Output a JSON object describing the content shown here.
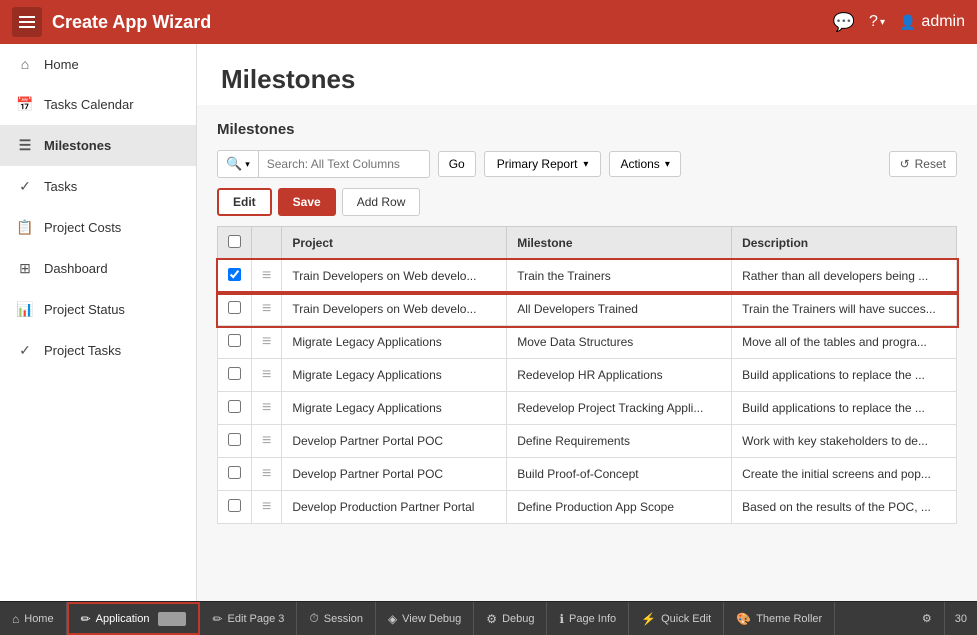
{
  "app": {
    "title": "Create App Wizard"
  },
  "nav_icons": {
    "chat": "💬",
    "help": "?",
    "user": "👤",
    "username": "admin"
  },
  "sidebar": {
    "items": [
      {
        "id": "home",
        "label": "Home",
        "icon": "⌂",
        "active": false
      },
      {
        "id": "tasks-calendar",
        "label": "Tasks Calendar",
        "icon": "📅",
        "active": false
      },
      {
        "id": "milestones",
        "label": "Milestones",
        "icon": "☰",
        "active": true
      },
      {
        "id": "tasks",
        "label": "Tasks",
        "icon": "✓",
        "active": false
      },
      {
        "id": "project-costs",
        "label": "Project Costs",
        "icon": "📋",
        "active": false
      },
      {
        "id": "dashboard",
        "label": "Dashboard",
        "icon": "⊞",
        "active": false
      },
      {
        "id": "project-status",
        "label": "Project Status",
        "icon": "📊",
        "active": false
      },
      {
        "id": "project-tasks",
        "label": "Project Tasks",
        "icon": "✓",
        "active": false
      }
    ]
  },
  "page": {
    "title": "Milestones",
    "section_title": "Milestones"
  },
  "toolbar": {
    "search_placeholder": "Search: All Text Columns",
    "go_label": "Go",
    "primary_report_label": "Primary Report",
    "actions_label": "Actions",
    "reset_label": "Reset"
  },
  "action_buttons": {
    "edit_label": "Edit",
    "save_label": "Save",
    "add_row_label": "Add Row"
  },
  "table": {
    "columns": [
      "",
      "",
      "Project",
      "Milestone",
      "Description"
    ],
    "rows": [
      {
        "checked": true,
        "highlighted": true,
        "project": "Train Developers on Web develo...",
        "milestone": "Train the Trainers",
        "description": "Rather than all developers being ..."
      },
      {
        "checked": false,
        "highlighted": true,
        "project": "Train Developers on Web develo...",
        "milestone": "All Developers Trained",
        "description": "Train the Trainers will have succes..."
      },
      {
        "checked": false,
        "highlighted": false,
        "project": "Migrate Legacy Applications",
        "milestone": "Move Data Structures",
        "description": "Move all of the tables and progra..."
      },
      {
        "checked": false,
        "highlighted": false,
        "project": "Migrate Legacy Applications",
        "milestone": "Redevelop HR Applications",
        "description": "Build applications to replace the ..."
      },
      {
        "checked": false,
        "highlighted": false,
        "project": "Migrate Legacy Applications",
        "milestone": "Redevelop Project Tracking Appli...",
        "description": "Build applications to replace the ..."
      },
      {
        "checked": false,
        "highlighted": false,
        "project": "Develop Partner Portal POC",
        "milestone": "Define Requirements",
        "description": "Work with key stakeholders to de..."
      },
      {
        "checked": false,
        "highlighted": false,
        "project": "Develop Partner Portal POC",
        "milestone": "Build Proof-of-Concept",
        "description": "Create the initial screens and pop..."
      },
      {
        "checked": false,
        "highlighted": false,
        "project": "Develop Production Partner Portal",
        "milestone": "Define Production App Scope",
        "description": "Based on the results of the POC, ..."
      }
    ]
  },
  "bottom_bar": {
    "items": [
      {
        "id": "home",
        "label": "Home",
        "icon": "⌂",
        "active": false
      },
      {
        "id": "application",
        "label": "Application",
        "icon": "✏",
        "active": true
      },
      {
        "id": "edit-page-3",
        "label": "Edit Page 3",
        "icon": "✏",
        "active": false
      },
      {
        "id": "session",
        "label": "Session",
        "icon": "⏱",
        "active": false
      },
      {
        "id": "view-debug",
        "label": "View Debug",
        "icon": "⬡",
        "active": false
      },
      {
        "id": "debug",
        "label": "Debug",
        "icon": "⚙",
        "active": false
      },
      {
        "id": "page-info",
        "label": "Page Info",
        "icon": "ℹ",
        "active": false
      },
      {
        "id": "quick-edit",
        "label": "Quick Edit",
        "icon": "⚡",
        "active": false
      },
      {
        "id": "theme-roller",
        "label": "Theme Roller",
        "icon": "🎨",
        "active": false
      }
    ],
    "page_number": "30"
  }
}
